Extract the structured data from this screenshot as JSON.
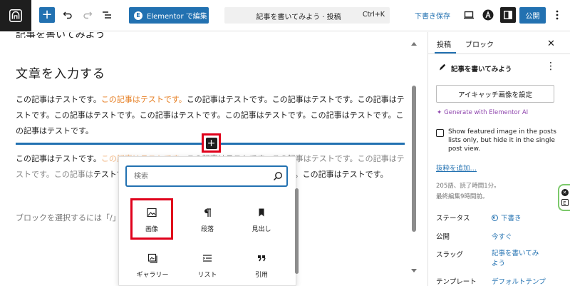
{
  "toolbar": {
    "elementor_label": "Elementor で編集",
    "command_title": "記事を書いてみよう · 投稿",
    "command_shortcut": "Ctrl+K",
    "save_draft_label": "下書き保存",
    "publish_label": "公開"
  },
  "editor": {
    "partial_top_text": "記事を書いてみよう",
    "heading": "文章を入力する",
    "para_text": "この記事はテストです。",
    "para_highlight": "この記事はテストです。",
    "para1_rest": "この記事はテストです。この記事はテストです。この記事はテストです。この記事はテストです。この記事はテストです。この記事はテストです。この記事はテストです。この記事はテストです。",
    "para2_rest_a": "この記事はテストです。この記事はテストです。この記事はテストです。この記事は",
    "para2_rest_b": "テストです。この記事は",
    "para2_rest_c": "ストです。この記事はテストです。この記事はテストです。",
    "placeholder_text": "ブロックを選択するには「/」"
  },
  "inserter": {
    "search_placeholder": "検索",
    "blocks": [
      {
        "label": "画像",
        "icon": "image-icon"
      },
      {
        "label": "段落",
        "icon": "paragraph-icon"
      },
      {
        "label": "見出し",
        "icon": "bookmark-icon"
      },
      {
        "label": "ギャラリー",
        "icon": "gallery-icon"
      },
      {
        "label": "リスト",
        "icon": "list-icon"
      },
      {
        "label": "引用",
        "icon": "quote-icon"
      }
    ]
  },
  "sidebar": {
    "tabs": [
      "投稿",
      "ブロック"
    ],
    "post_title": "記事を書いてみよう",
    "featured_image_label": "アイキャッチ画像を設定",
    "generate_ai_label": "Generate with Elementor AI",
    "show_featured_label": "Show featured image in the posts lists only, but hide it in the single post view.",
    "excerpt_label": "抜粋を追加…",
    "meta_line1": "205語、読了時間1分。",
    "meta_line2": "最終編集9時間前。",
    "rows": [
      {
        "label": "ステータス",
        "value": "下書き"
      },
      {
        "label": "公開",
        "value": "今すぐ"
      },
      {
        "label": "スラッグ",
        "value": "記事を書いてみ",
        "value2": "よう"
      },
      {
        "label": "テンプレート",
        "value": "デフォルトテンプ"
      }
    ]
  },
  "colors": {
    "accent": "#2271b1",
    "highlight": "#e67e22",
    "annotation": "#e0001b",
    "ai": "#8e44ad"
  }
}
